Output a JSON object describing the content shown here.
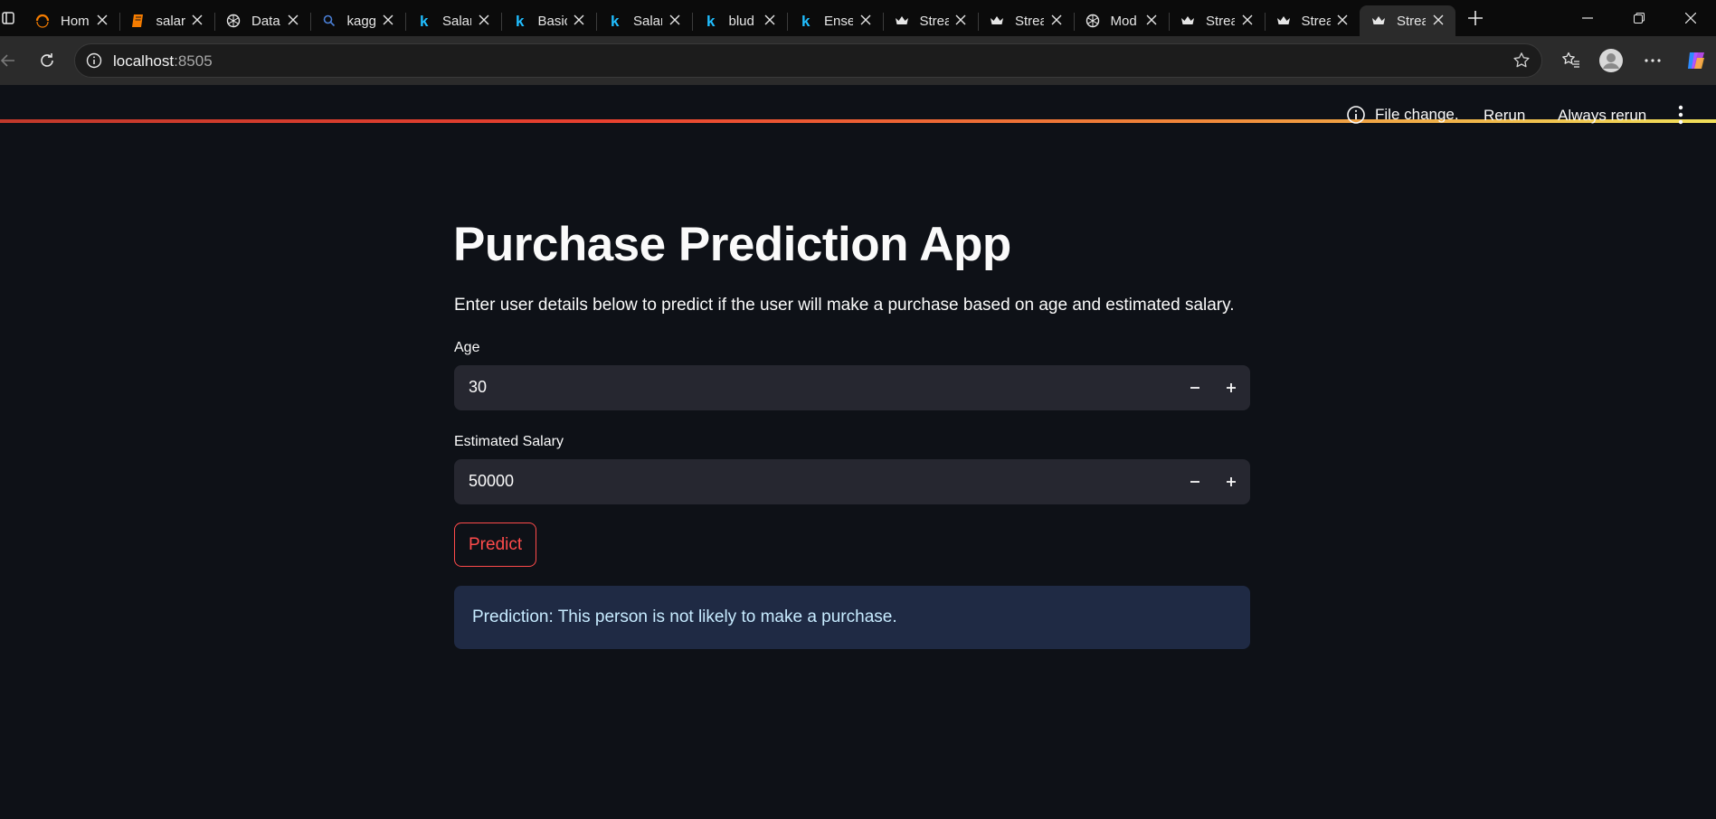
{
  "browser": {
    "tabs": [
      {
        "label": "Hom",
        "icon": "orange-ring-icon"
      },
      {
        "label": "salar",
        "icon": "notebook-icon"
      },
      {
        "label": "Data",
        "icon": "chatgpt-icon"
      },
      {
        "label": "kagg",
        "icon": "search-icon"
      },
      {
        "label": "Salar",
        "icon": "kaggle-icon"
      },
      {
        "label": "Basic",
        "icon": "kaggle-icon"
      },
      {
        "label": "Salar",
        "icon": "kaggle-icon"
      },
      {
        "label": "blud",
        "icon": "kaggle-icon"
      },
      {
        "label": "Ense",
        "icon": "kaggle-icon"
      },
      {
        "label": "Strea",
        "icon": "streamlit-crown-icon"
      },
      {
        "label": "Strea",
        "icon": "streamlit-crown-icon"
      },
      {
        "label": "Mod",
        "icon": "chatgpt-icon"
      },
      {
        "label": "Strea",
        "icon": "streamlit-crown-icon"
      },
      {
        "label": "Strea",
        "icon": "streamlit-crown-icon"
      },
      {
        "label": "Strea",
        "icon": "streamlit-crown-icon",
        "active": true
      }
    ],
    "address": {
      "host": "localhost",
      "port": ":8505"
    }
  },
  "app": {
    "header": {
      "status": "File change.",
      "rerun": "Rerun",
      "always_rerun": "Always rerun"
    },
    "title": "Purchase Prediction App",
    "description": "Enter user details below to predict if the user will make a purchase based on age and estimated salary.",
    "age": {
      "label": "Age",
      "value": "30"
    },
    "salary": {
      "label": "Estimated Salary",
      "value": "50000"
    },
    "predict_label": "Predict",
    "result": "Prediction: This person is not likely to make a purchase.",
    "colors": {
      "background": "#0e1117",
      "primary": "#ff4b4b",
      "input_bg": "#262730",
      "info_bg": "#1f2a44",
      "info_text": "#c7ebff"
    }
  }
}
